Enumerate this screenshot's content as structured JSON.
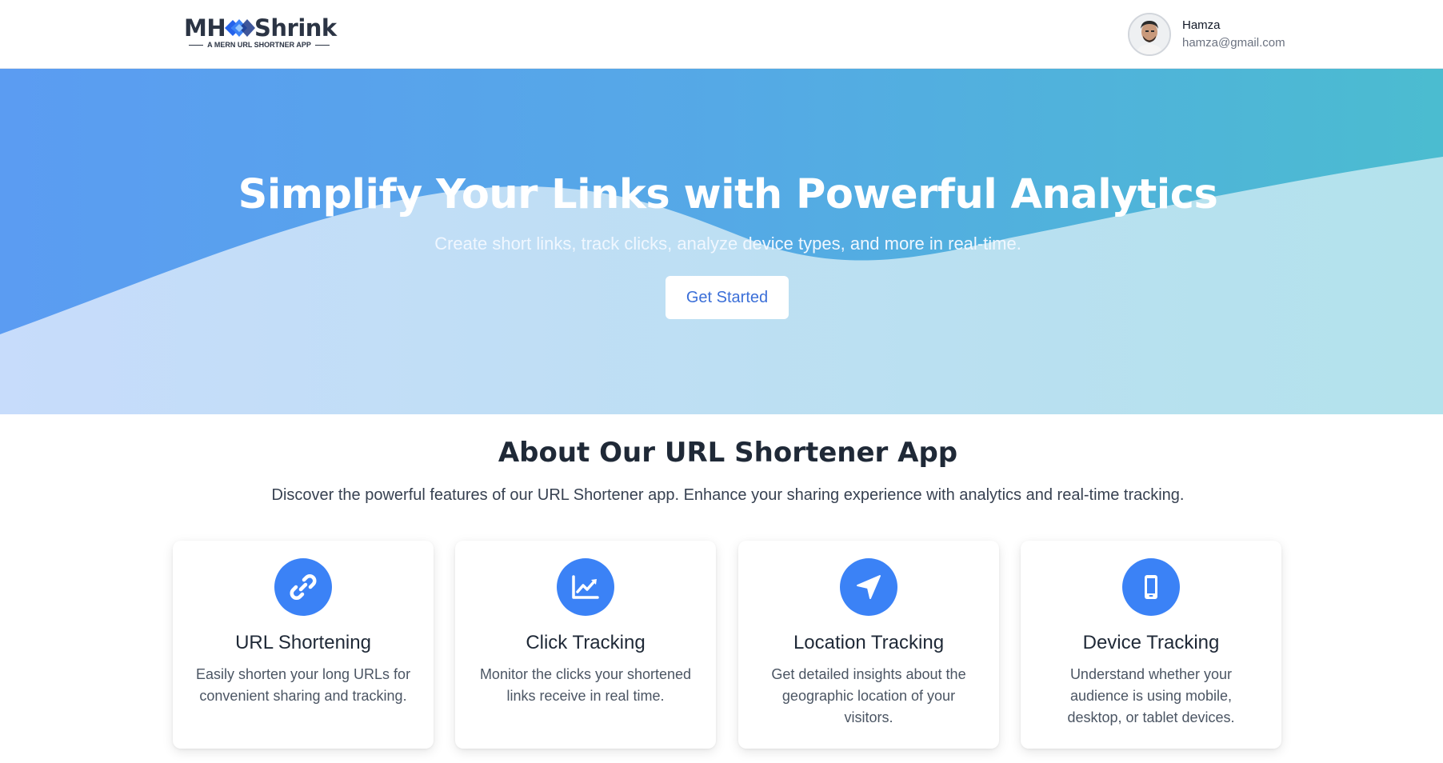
{
  "header": {
    "logo": {
      "left": "MH",
      "right": "Shrink",
      "tagline": "A MERN URL SHORTNER APP"
    },
    "user": {
      "name": "Hamza",
      "email": "hamza@gmail.com"
    }
  },
  "hero": {
    "title": "Simplify Your Links with Powerful Analytics",
    "subtitle": "Create short links, track clicks, analyze device types, and more in real-time.",
    "cta_label": "Get Started"
  },
  "about": {
    "title": "About Our URL Shortener App",
    "description": "Discover the powerful features of our URL Shortener app. Enhance your sharing experience with analytics and real-time tracking."
  },
  "features": [
    {
      "icon": "link-icon",
      "title": "URL Shortening",
      "description": "Easily shorten your long URLs for convenient sharing and tracking."
    },
    {
      "icon": "chart-icon",
      "title": "Click Tracking",
      "description": "Monitor the clicks your shortened links receive in real time."
    },
    {
      "icon": "location-arrow-icon",
      "title": "Location Tracking",
      "description": "Get detailed insights about the geographic location of your visitors."
    },
    {
      "icon": "mobile-icon",
      "title": "Device Tracking",
      "description": "Understand whether your audience is using mobile, desktop, or tablet devices."
    }
  ],
  "colors": {
    "accent": "#3b82f6",
    "hero_start": "#5b9cf2",
    "hero_end": "#4bbcd0",
    "button_text": "#3b6fd8"
  }
}
